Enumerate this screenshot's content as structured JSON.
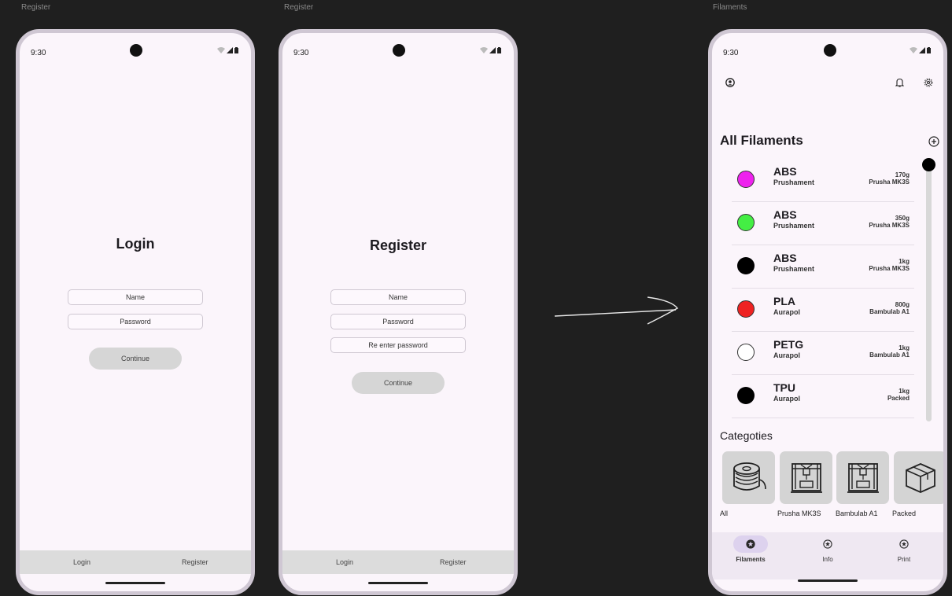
{
  "frames": {
    "frame1_label": "Register",
    "frame2_label": "Register",
    "frame3_label": "Filaments"
  },
  "status": {
    "time": "9:30"
  },
  "login": {
    "title": "Login",
    "name_placeholder": "Name",
    "password_placeholder": "Password",
    "continue_label": "Continue",
    "nav_login": "Login",
    "nav_register": "Register"
  },
  "register": {
    "title": "Register",
    "name_placeholder": "Name",
    "password_placeholder": "Password",
    "reenter_placeholder": "Re enter password",
    "continue_label": "Continue",
    "nav_login": "Login",
    "nav_register": "Register"
  },
  "filaments": {
    "title": "All Filaments",
    "items": [
      {
        "material": "ABS",
        "brand": "Prushament",
        "weight": "170g",
        "printer": "Prusha MK3S",
        "color": "#ee22ee"
      },
      {
        "material": "ABS",
        "brand": "Prushament",
        "weight": "350g",
        "printer": "Prusha MK3S",
        "color": "#44ee44"
      },
      {
        "material": "ABS",
        "brand": "Prushament",
        "weight": "1kg",
        "printer": "Prusha MK3S",
        "color": "#000000"
      },
      {
        "material": "PLA",
        "brand": "Aurapol",
        "weight": "800g",
        "printer": "Bambulab A1",
        "color": "#ee2222"
      },
      {
        "material": "PETG",
        "brand": "Aurapol",
        "weight": "1kg",
        "printer": "Bambulab A1",
        "color": "#ffffff"
      },
      {
        "material": "TPU",
        "brand": "Aurapol",
        "weight": "1kg",
        "printer": "Packed",
        "color": "#000000"
      }
    ],
    "categories_title": "Categoties",
    "categories": [
      {
        "label": "All",
        "icon": "spool-icon"
      },
      {
        "label": "Prusha MK3S",
        "icon": "printer-icon"
      },
      {
        "label": "Bambulab A1",
        "icon": "printer-icon"
      },
      {
        "label": "Packed",
        "icon": "box-icon"
      }
    ],
    "nav": [
      {
        "label": "Filaments",
        "active": true
      },
      {
        "label": "Info",
        "active": false
      },
      {
        "label": "Print",
        "active": false
      }
    ]
  }
}
